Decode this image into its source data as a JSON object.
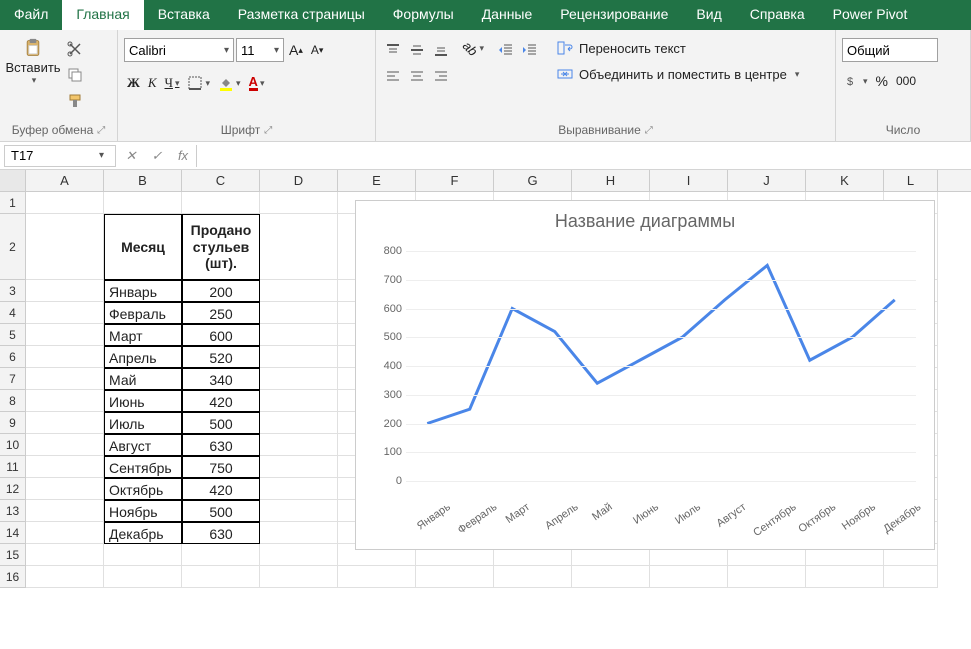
{
  "tabs": [
    "Файл",
    "Главная",
    "Вставка",
    "Разметка страницы",
    "Формулы",
    "Данные",
    "Рецензирование",
    "Вид",
    "Справка",
    "Power Pivot"
  ],
  "active_tab": 1,
  "ribbon": {
    "clipboard": {
      "paste": "Вставить",
      "label": "Буфер обмена"
    },
    "font": {
      "family": "Calibri",
      "size": "11",
      "label": "Шрифт",
      "bold": "Ж",
      "italic": "К",
      "underline": "Ч"
    },
    "align": {
      "wrap": "Переносить текст",
      "merge": "Объединить и поместить в центре",
      "label": "Выравнивание"
    },
    "number": {
      "format": "Общий",
      "label": "Число"
    }
  },
  "namebox": "T17",
  "columns": [
    "A",
    "B",
    "C",
    "D",
    "E",
    "F",
    "G",
    "H",
    "I",
    "J",
    "K",
    "L"
  ],
  "header_row": {
    "b": "Месяц",
    "c": "Продано стульев (шт)."
  },
  "rows": [
    {
      "n": 1
    },
    {
      "n": 2,
      "tall": true,
      "hdr": true
    },
    {
      "n": 3,
      "b": "Январь",
      "c": "200"
    },
    {
      "n": 4,
      "b": "Февраль",
      "c": "250"
    },
    {
      "n": 5,
      "b": "Март",
      "c": "600"
    },
    {
      "n": 6,
      "b": "Апрель",
      "c": "520"
    },
    {
      "n": 7,
      "b": "Май",
      "c": "340"
    },
    {
      "n": 8,
      "b": "Июнь",
      "c": "420"
    },
    {
      "n": 9,
      "b": "Июль",
      "c": "500"
    },
    {
      "n": 10,
      "b": "Август",
      "c": "630"
    },
    {
      "n": 11,
      "b": "Сентябрь",
      "c": "750"
    },
    {
      "n": 12,
      "b": "Октябрь",
      "c": "420"
    },
    {
      "n": 13,
      "b": "Ноябрь",
      "c": "500"
    },
    {
      "n": 14,
      "b": "Декабрь",
      "c": "630"
    },
    {
      "n": 15
    },
    {
      "n": 16
    }
  ],
  "chart_data": {
    "type": "line",
    "title": "Название диаграммы",
    "categories": [
      "Январь",
      "Февраль",
      "Март",
      "Апрель",
      "Май",
      "Июнь",
      "Июль",
      "Август",
      "Сентябрь",
      "Октябрь",
      "Ноябрь",
      "Декабрь"
    ],
    "values": [
      200,
      250,
      600,
      520,
      340,
      420,
      500,
      630,
      750,
      420,
      500,
      630
    ],
    "ylim": [
      0,
      800
    ],
    "yticks": [
      0,
      100,
      200,
      300,
      400,
      500,
      600,
      700,
      800
    ],
    "xlabel": "",
    "ylabel": ""
  }
}
